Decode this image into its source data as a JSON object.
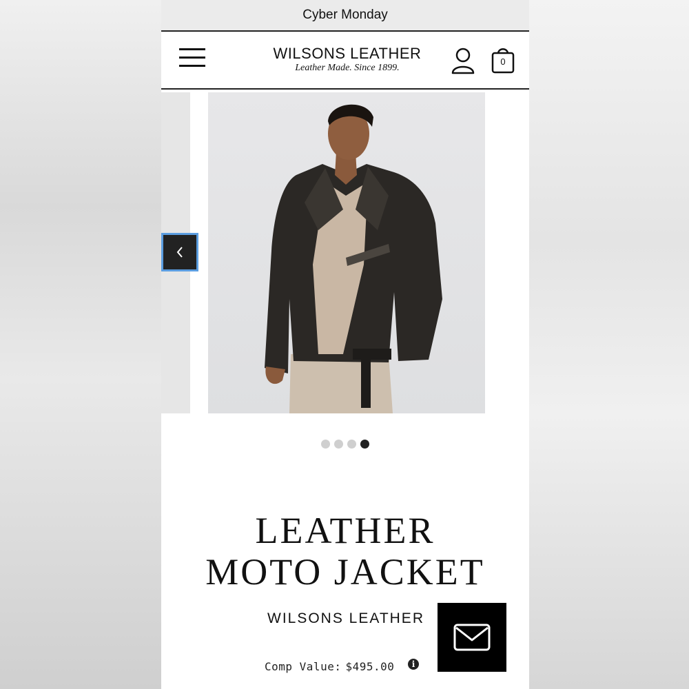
{
  "promo": {
    "text": "Cyber Monday"
  },
  "header": {
    "logo_main": "WILSONS LEATHER",
    "logo_tagline": "Leather Made. Since 1899.",
    "cart_count": "0"
  },
  "carousel": {
    "dots": [
      {
        "active": false
      },
      {
        "active": false
      },
      {
        "active": false
      },
      {
        "active": true
      }
    ]
  },
  "product": {
    "title_line1": "LEATHER",
    "title_line2": "MOTO JACKET",
    "brand": "WILSONS LEATHER",
    "comp_value_label": "Comp Value:",
    "comp_value_price": "$495.00"
  },
  "icons": {
    "menu": "hamburger-icon",
    "account": "user-icon",
    "cart": "shopping-bag-icon",
    "prev": "chevron-left-icon",
    "info": "info-icon",
    "email": "envelope-icon"
  },
  "colors": {
    "accent_focus": "#5b9de0",
    "dark": "#222222"
  }
}
